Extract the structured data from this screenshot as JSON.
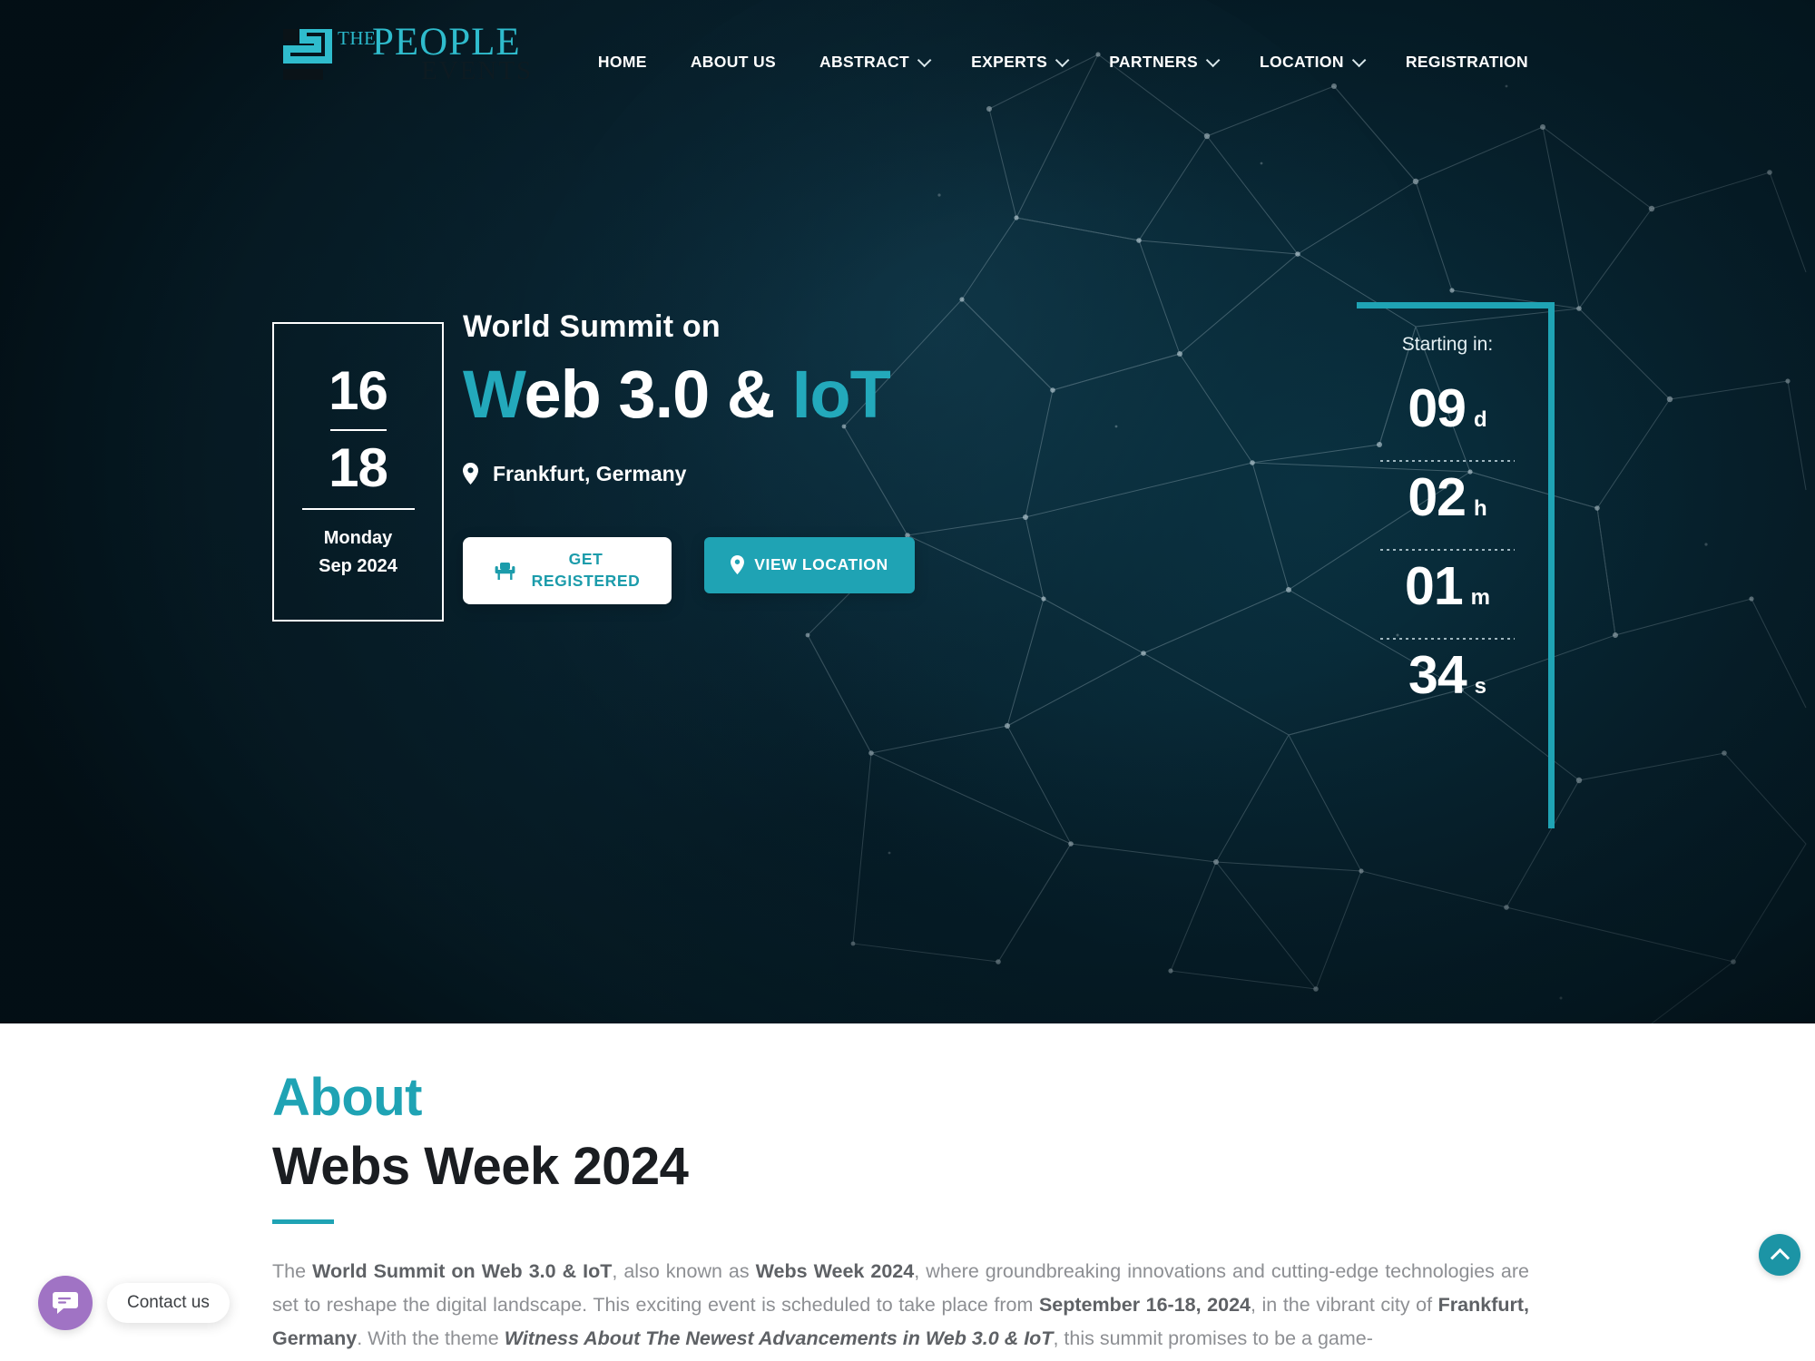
{
  "header": {
    "logo": {
      "the": "THE",
      "people": "PEOPLE",
      "events": "EVENTS"
    },
    "nav": [
      {
        "label": "HOME",
        "has_dropdown": false
      },
      {
        "label": "ABOUT US",
        "has_dropdown": false
      },
      {
        "label": "ABSTRACT",
        "has_dropdown": true
      },
      {
        "label": "EXPERTS",
        "has_dropdown": true
      },
      {
        "label": "PARTNERS",
        "has_dropdown": true
      },
      {
        "label": "LOCATION",
        "has_dropdown": true
      },
      {
        "label": "REGISTRATION",
        "has_dropdown": false
      }
    ]
  },
  "hero": {
    "date_card": {
      "day_start": "16",
      "day_end": "18",
      "weekday": "Monday",
      "month_year": "Sep 2024"
    },
    "kicker": "World Summit on",
    "title_accent_1": "W",
    "title_white": "eb 3.0 &",
    "title_accent_2": "IoT",
    "venue": "Frankfurt, Germany",
    "buttons": {
      "register": "GET REGISTERED",
      "register_line1": "GET",
      "register_line2": "REGISTERED",
      "location": "VIEW LOCATION"
    },
    "countdown": {
      "label": "Starting in:",
      "units": [
        {
          "value": "09",
          "unit": "d"
        },
        {
          "value": "02",
          "unit": "h"
        },
        {
          "value": "01",
          "unit": "m"
        },
        {
          "value": "34",
          "unit": "s"
        }
      ]
    }
  },
  "about": {
    "kicker": "About",
    "title": "Webs Week 2024",
    "paragraph_html": "The <b>World Summit on Web 3.0 &amp; IoT</b>, also known as <b>Webs Week 2024</b>, where groundbreaking innovations and cutting-edge technologies are set to reshape the digital landscape. This exciting event is scheduled to take place from <b>September 16-18, 2024</b>, in the vibrant city of <b>Frankfurt, Germany</b>. With the theme <i>Witness About The Newest Advancements in Web 3.0 &amp; IoT</i>, this summit promises to be a game-"
  },
  "widgets": {
    "chat_label": "Contact us",
    "chat_icon": "chat-bubble-icon",
    "to_top_icon": "chevron-up-icon"
  },
  "colors": {
    "accent": "#1fa3b4",
    "accent_text": "#23a9bb",
    "hero_bg": "#082733",
    "chat_purple": "#a073c4",
    "body_text": "#8d8f93"
  }
}
